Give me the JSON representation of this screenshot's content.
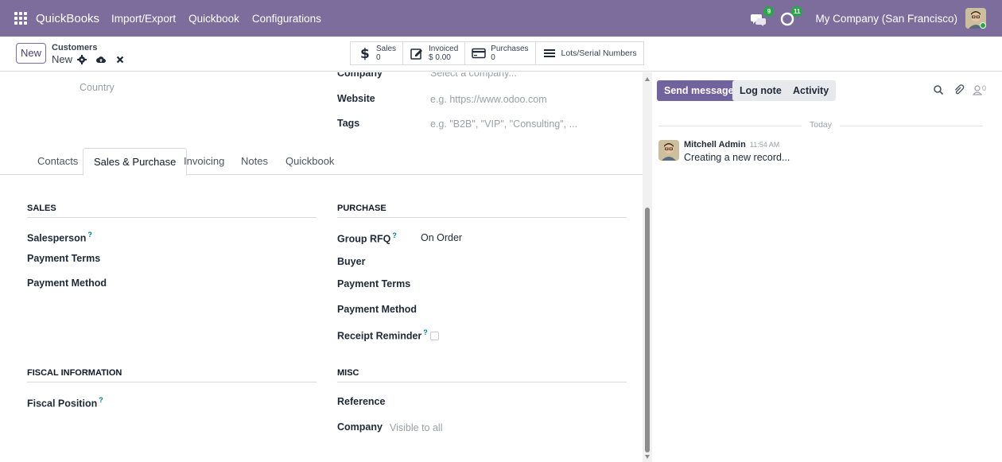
{
  "navbar": {
    "brand": "QuickBooks",
    "menus": [
      "Import/Export",
      "Quickbook",
      "Configurations"
    ],
    "messages_badge": "9",
    "activities_badge": "11",
    "company": "My Company (San Francisco)",
    "color": "#7c6d9c"
  },
  "control_panel": {
    "new_label": "New",
    "breadcrumb_parent": "Customers",
    "breadcrumb_current": "New",
    "smart_buttons": {
      "sales": {
        "label": "Sales",
        "value": "0"
      },
      "invoiced": {
        "label": "Invoiced",
        "value": "$ 0.00"
      },
      "purchases": {
        "label": "Purchases",
        "value": "0"
      },
      "lots": {
        "label": "Lots/Serial Numbers"
      }
    }
  },
  "form": {
    "country_placeholder": "Country",
    "company_label": "Company",
    "company_placeholder": "Select a company...",
    "website_label": "Website",
    "website_placeholder": "e.g. https://www.odoo.com",
    "tags_label": "Tags",
    "tags_placeholder": "e.g. \"B2B\", \"VIP\", \"Consulting\", ...",
    "tabs": [
      "Contacts",
      "Sales & Purchase",
      "Invoicing",
      "Notes",
      "Quickbook"
    ],
    "sales": {
      "title": "SALES",
      "salesperson": "Salesperson",
      "payment_terms": "Payment Terms",
      "payment_method": "Payment Method"
    },
    "purchase": {
      "title": "PURCHASE",
      "group_rfq": "Group RFQ",
      "group_rfq_value": "On Order",
      "buyer": "Buyer",
      "payment_terms": "Payment Terms",
      "payment_method": "Payment Method",
      "receipt_reminder": "Receipt Reminder"
    },
    "fiscal": {
      "title": "FISCAL INFORMATION",
      "fiscal_position": "Fiscal Position"
    },
    "misc": {
      "title": "MISC",
      "reference": "Reference",
      "company": "Company",
      "company_placeholder": "Visible to all"
    },
    "help_mark": "?"
  },
  "chatter": {
    "send_message": "Send message",
    "log_note": "Log note",
    "activity": "Activity",
    "followers_count": "0",
    "today": "Today",
    "message": {
      "author": "Mitchell Admin",
      "time": "11:54 AM",
      "body": "Creating a new record..."
    }
  }
}
